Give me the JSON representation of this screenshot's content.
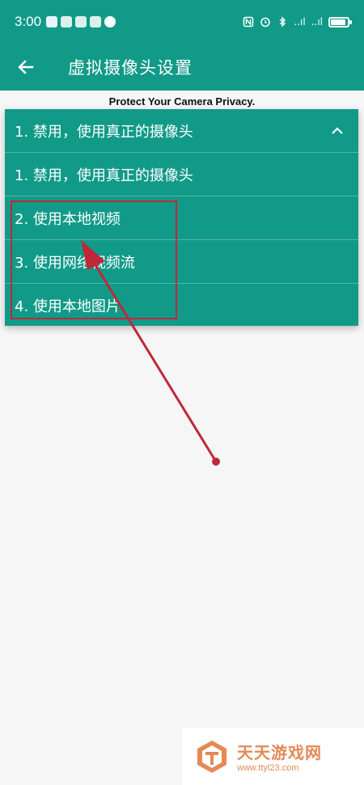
{
  "status_bar": {
    "time": "3:00",
    "signal1": "..ıl",
    "signal2": "..ıl"
  },
  "app_bar": {
    "title": "虚拟摄像头设置"
  },
  "privacy_banner": "Protect Your Camera Privacy.",
  "dropdown": {
    "selected_label": "1. 禁用，使用真正的摄像头",
    "options": [
      "1. 禁用，使用真正的摄像头",
      "2. 使用本地视频",
      "3. 使用网络视频流",
      "4. 使用本地图片"
    ]
  },
  "watermark": {
    "name": "天天游戏网",
    "url": "www.ttyl23.com"
  },
  "colors": {
    "primary": "#119a88",
    "annotation": "#c0283a",
    "background": "#f6f6f6",
    "watermark": "#e38a57"
  },
  "icons": {
    "back": "arrow-left-icon",
    "expand": "chevron-up-icon"
  }
}
